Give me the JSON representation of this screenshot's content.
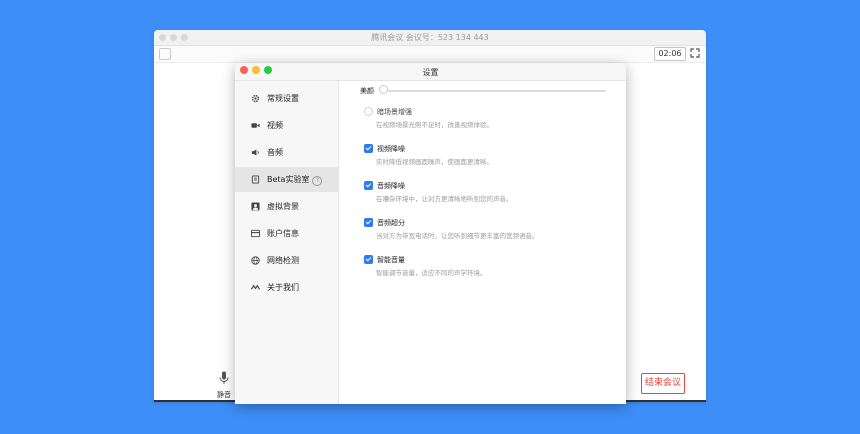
{
  "main_window": {
    "title": "腾讯会议 会议号：523 134 443",
    "timer": "02:06",
    "mute_label": "静音",
    "end_meeting_label": "结束会议",
    "icons": {
      "shield": "shield-icon",
      "fullscreen": "fullscreen-icon",
      "microphone": "microphone-icon"
    }
  },
  "settings": {
    "title": "设置",
    "traffic_colors": {
      "close": "#fe5f57",
      "minimize": "#febc2e",
      "zoom": "#28c840"
    },
    "accent_color": "#2d7bf0",
    "sidebar": {
      "items": [
        {
          "label": "常规设置",
          "icon": "gear-icon"
        },
        {
          "label": "视频",
          "icon": "video-camera-icon"
        },
        {
          "label": "音频",
          "icon": "speaker-icon"
        },
        {
          "label": "Beta实验室",
          "icon": "lab-icon",
          "active": true,
          "help": "?"
        },
        {
          "label": "虚拟背景",
          "icon": "portrait-icon"
        },
        {
          "label": "账户信息",
          "icon": "card-icon"
        },
        {
          "label": "网络检测",
          "icon": "globe-icon"
        },
        {
          "label": "关于我们",
          "icon": "logo-icon"
        }
      ]
    },
    "beauty": {
      "label": "美颜",
      "value": 0
    },
    "options": [
      {
        "title": "暗场景增强",
        "desc": "在视频场景光照不足时，改善视频体验。",
        "checked": false
      },
      {
        "title": "视频降噪",
        "desc": "实时降低视频画面噪声，使画面更清晰。",
        "checked": true
      },
      {
        "title": "音频降噪",
        "desc": "在嘈杂环境中，让对方更清晰地听到您的声音。",
        "checked": true
      },
      {
        "title": "音频超分",
        "desc": "当对方为带宽电话时，让您听到细节更丰富的宽频语音。",
        "checked": true
      },
      {
        "title": "智能音量",
        "desc": "智能调节音量，适应不同的声学环境。",
        "checked": true
      }
    ]
  }
}
